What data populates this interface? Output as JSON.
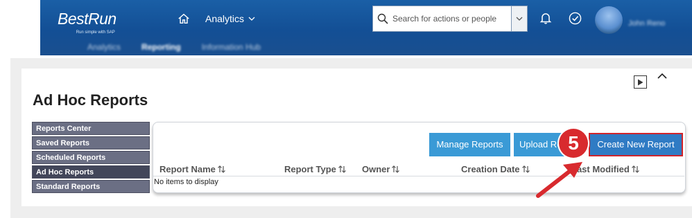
{
  "shell": {
    "logo": "BestRun",
    "logo_tagline": "Run simple with SAP",
    "nav_menu": "Analytics",
    "search": {
      "placeholder": "Search for actions or people"
    },
    "user_name": "John Reno",
    "subnav": [
      "Analytics",
      "Reporting",
      "Information Hub"
    ],
    "subnav_active": "Reporting"
  },
  "page": {
    "title": "Ad Hoc Reports"
  },
  "side_menu": {
    "items": [
      {
        "label": "Reports Center"
      },
      {
        "label": "Saved Reports"
      },
      {
        "label": "Scheduled Reports"
      },
      {
        "label": "Ad Hoc Reports",
        "selected": true
      },
      {
        "label": "Standard Reports"
      }
    ]
  },
  "toolbar": {
    "manage_label": "Manage Reports",
    "upload_label": "Upload Reports",
    "create_label": "Create New Report"
  },
  "table": {
    "columns": [
      "Report Name",
      "Report Type",
      "Owner",
      "Creation Date",
      "Last Modified"
    ],
    "empty_text": "No items to display"
  },
  "annotation": {
    "step": "5",
    "color": "#d82a2e"
  },
  "colors": {
    "shell": "#134f95",
    "button": "#3a9ad6",
    "menu": "#6b6f84"
  }
}
